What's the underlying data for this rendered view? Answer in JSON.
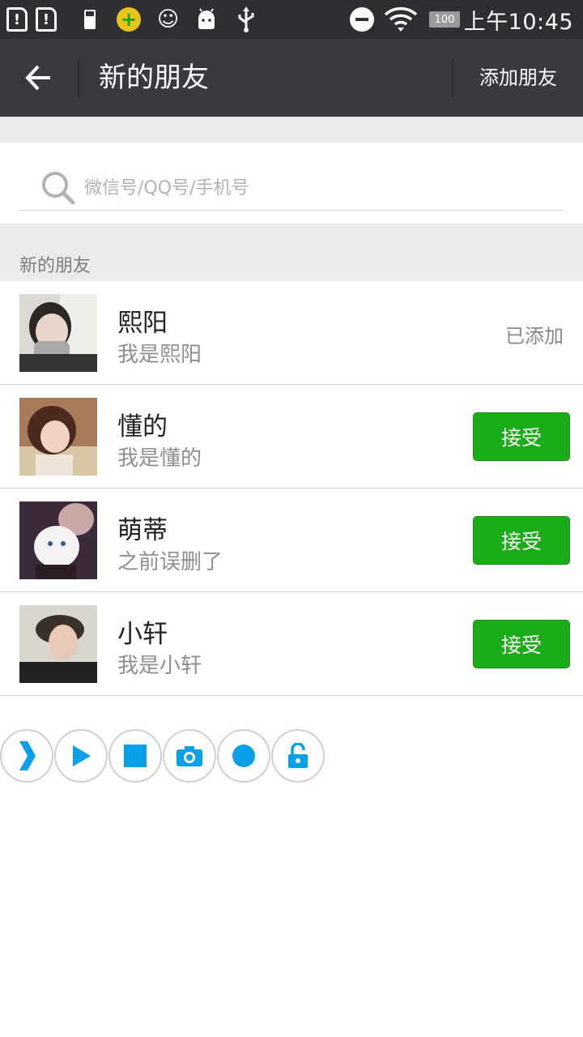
{
  "status_bar": {
    "time": "上午10:45",
    "battery_level": "100",
    "icons": [
      "sim1-alert-icon",
      "sim2-alert-icon",
      "battery-small-icon",
      "security-app-icon",
      "emoji-icon",
      "android-icon",
      "usb-icon",
      "dnd-icon",
      "wifi-icon",
      "battery-icon"
    ]
  },
  "toolbar": {
    "title": "新的朋友",
    "add_label": "添加朋友"
  },
  "search": {
    "placeholder": "微信号/QQ号/手机号"
  },
  "section": {
    "title": "新的朋友"
  },
  "friends": [
    {
      "name": "熙阳",
      "message": "我是熙阳",
      "status": "已添加"
    },
    {
      "name": "懂的",
      "message": "我是懂的",
      "action": "接受"
    },
    {
      "name": "萌蒂",
      "message": "之前误删了",
      "action": "接受"
    },
    {
      "name": "小轩",
      "message": "我是小轩",
      "action": "接受"
    }
  ],
  "controls": {
    "icons": [
      "expand-icon",
      "play-icon",
      "stop-icon",
      "camera-icon",
      "record-icon",
      "unlock-icon"
    ]
  },
  "colors": {
    "toolbar_bg": "#393a3f",
    "status_bg": "#2f2f33",
    "accept_green": "#1aad19",
    "control_blue": "#0aa0e8"
  }
}
